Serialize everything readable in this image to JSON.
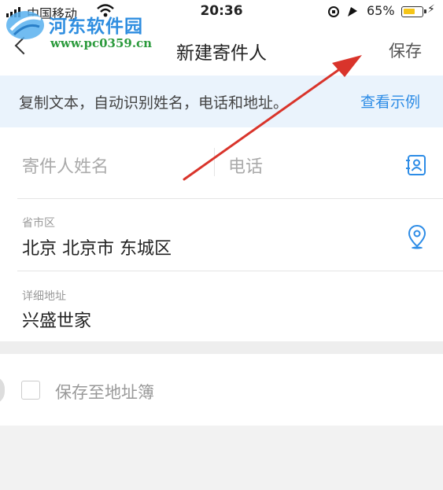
{
  "status_bar": {
    "carrier": "中国移动",
    "time": "20:36",
    "battery_percent": "65%",
    "battery_level": 0.65
  },
  "watermark": {
    "site_name": "河东软件园",
    "url": "www.pc0359.cn"
  },
  "nav": {
    "title": "新建寄件人",
    "save_label": "保存"
  },
  "hint": {
    "text": "复制文本，自动识别姓名，电话和地址。",
    "link": "查看示例"
  },
  "form": {
    "name_placeholder": "寄件人姓名",
    "phone_placeholder": "电话",
    "region_label": "省市区",
    "region_value": "北京 北京市 东城区",
    "address_label": "详细地址",
    "address_value": "兴盛世家"
  },
  "save_to_book": {
    "label": "保存至地址簿",
    "checked": false
  },
  "colors": {
    "accent": "#2d8ce6",
    "hint_bg": "#eaf3fc",
    "annotation_arrow": "#d9342b"
  }
}
